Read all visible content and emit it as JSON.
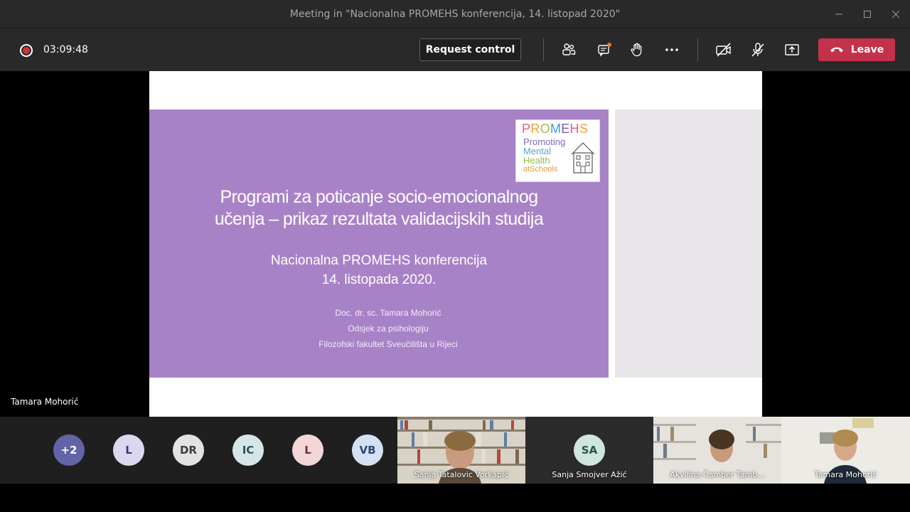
{
  "window": {
    "title": "Meeting in \"Nacionalna PROMEHS konferencija, 14. listopad 2020\"",
    "controls": [
      "minimize",
      "maximize",
      "close"
    ]
  },
  "toolbar": {
    "timer": "03:09:48",
    "request_control_label": "Request control",
    "leave_label": "Leave",
    "icons": [
      "people-icon",
      "chat-icon",
      "raise-hand-icon",
      "more-icon",
      "camera-off-icon",
      "mic-off-icon",
      "share-tray-icon"
    ],
    "colors": {
      "leave": "#c4314b",
      "recording": "#d13438"
    }
  },
  "slide": {
    "logo_title": "PROMEHS",
    "logo_lines": [
      "Promoting",
      "Mental",
      "Health",
      "atSchools"
    ],
    "title_line1": "Programi za poticanje socio-emocionalnog",
    "title_line2": "učenja – prikaz rezultata validacijskih studija",
    "subtitle_line1": "Nacionalna PROMEHS konferencija",
    "subtitle_line2": "14. listopada 2020.",
    "author_line1": "Doc. dr. sc. Tamara Mohorić",
    "author_line2": "Odsjek za psihologiju",
    "author_line3": "Filozofski fakultet Sveučilišta u Rijeci",
    "background": "#a882c7"
  },
  "presenter_name": "Tamara Mohorić",
  "participants": {
    "avatars": [
      {
        "initials": "+2",
        "color": "#6264a7",
        "text_color": "#ffffff"
      },
      {
        "initials": "L",
        "color": "#dcd6ef",
        "text_color": "#3b3a6e"
      },
      {
        "initials": "DR",
        "color": "#e2e2e2",
        "text_color": "#3c3c3c"
      },
      {
        "initials": "IC",
        "color": "#d6e6e8",
        "text_color": "#2f4f56"
      },
      {
        "initials": "L",
        "color": "#f3d6d8",
        "text_color": "#6e2e36"
      },
      {
        "initials": "VB",
        "color": "#d3e1f2",
        "text_color": "#2a4a74"
      }
    ],
    "video_tiles": [
      {
        "name": "Sanja Tatalovic Vorkapić"
      },
      {
        "name": "Akvilina Čamber Tamb..."
      },
      {
        "name": "Tamara Mohorić"
      }
    ],
    "audio_tile": {
      "initials": "SA",
      "name": "Sanja Smojver Ažić"
    }
  }
}
